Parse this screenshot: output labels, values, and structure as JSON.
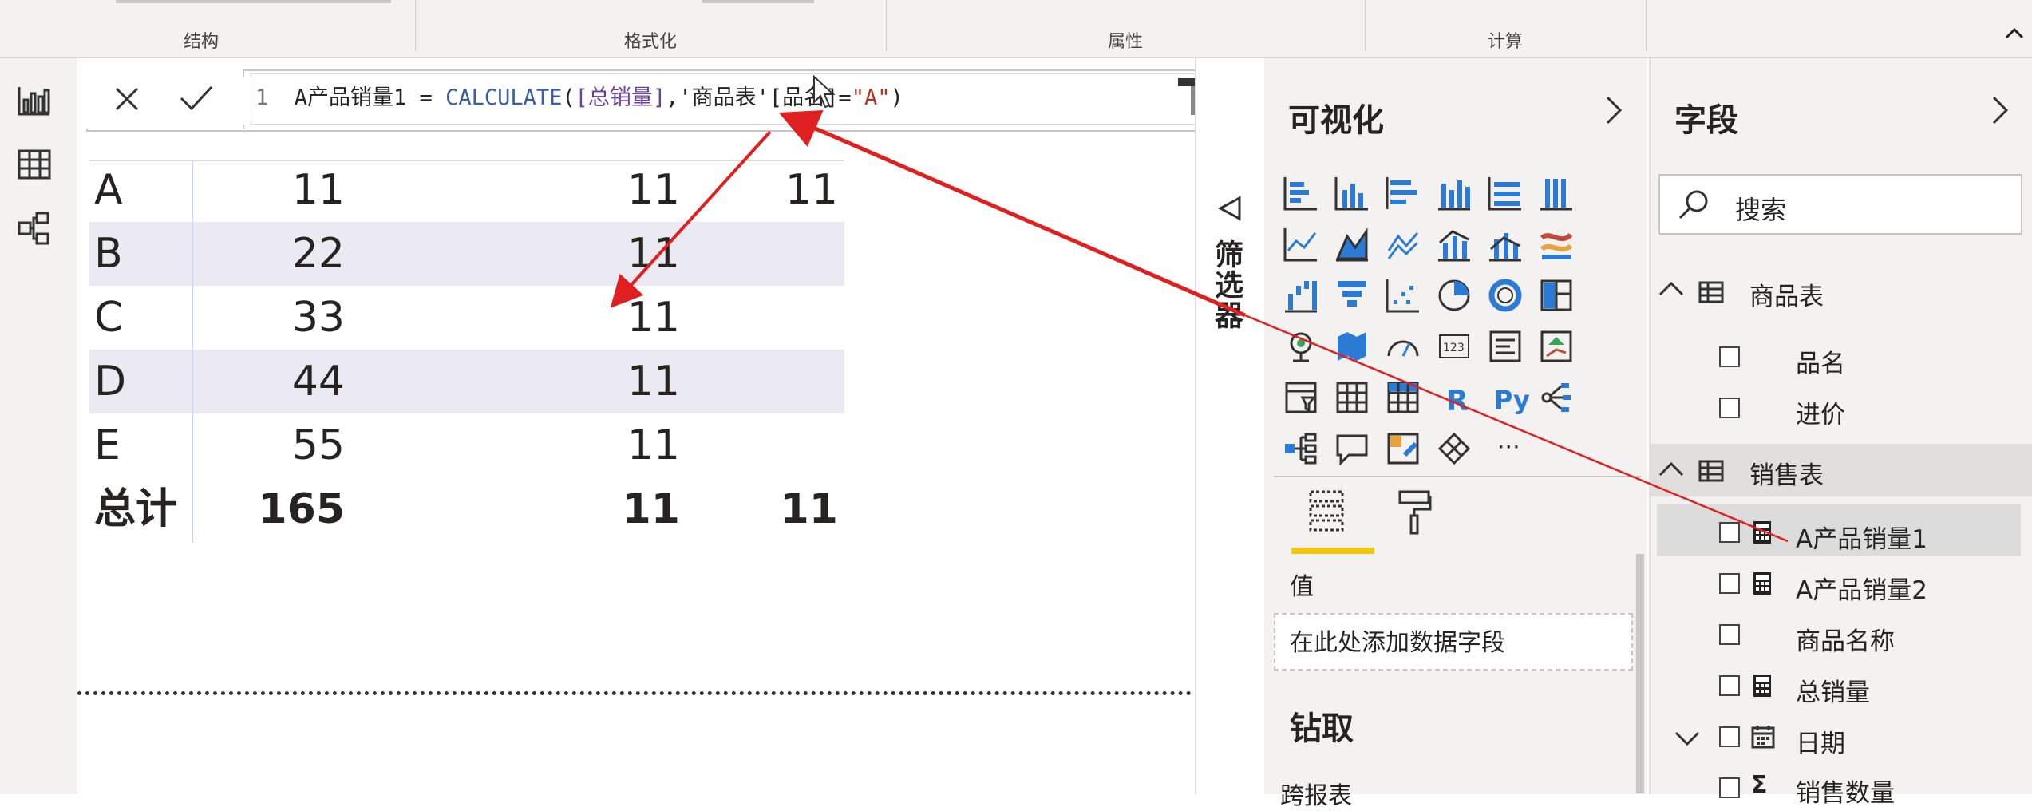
{
  "ribbon": {
    "groups": [
      "结构",
      "格式化",
      "属性",
      "计算"
    ]
  },
  "formula_bar": {
    "cancel_icon": "close-icon",
    "commit_icon": "check-icon",
    "line_number": "1",
    "tokens": {
      "measure_name": "A产品销量1 = ",
      "fn": "CALCULATE",
      "open": "(",
      "measure_ref": "[总销量]",
      "sep": ",'商品表'[品名]=",
      "str": "\"A\"",
      "close": ")"
    }
  },
  "table": {
    "rows": [
      {
        "label": "A",
        "v1": "11",
        "v2": "11",
        "v3": "11"
      },
      {
        "label": "B",
        "v1": "22",
        "v2": "11",
        "v3": ""
      },
      {
        "label": "C",
        "v1": "33",
        "v2": "11",
        "v3": ""
      },
      {
        "label": "D",
        "v1": "44",
        "v2": "11",
        "v3": ""
      },
      {
        "label": "E",
        "v1": "55",
        "v2": "11",
        "v3": ""
      }
    ],
    "total": {
      "label": "总计",
      "v1": "165",
      "v2": "11",
      "v3": "11"
    }
  },
  "filters": {
    "label": "筛选器"
  },
  "visualizations": {
    "title": "可视化",
    "wells_label": "值",
    "well_placeholder": "在此处添加数据字段",
    "drill_title": "钻取",
    "cross_report": "跨报表",
    "r_label": "R",
    "py_label": "Py",
    "more_label": "···"
  },
  "fields": {
    "title": "字段",
    "search_placeholder": "搜索",
    "tables": [
      {
        "name": "商品表",
        "items": [
          "品名",
          "进价"
        ]
      },
      {
        "name": "销售表",
        "items": [
          "A产品销量1",
          "A产品销量2",
          "商品名称",
          "总销量",
          "日期",
          "销售数量"
        ]
      }
    ]
  },
  "colors": {
    "accent": "#f2c811",
    "arrow": "#e02020",
    "shade": "#ebe9f2"
  }
}
